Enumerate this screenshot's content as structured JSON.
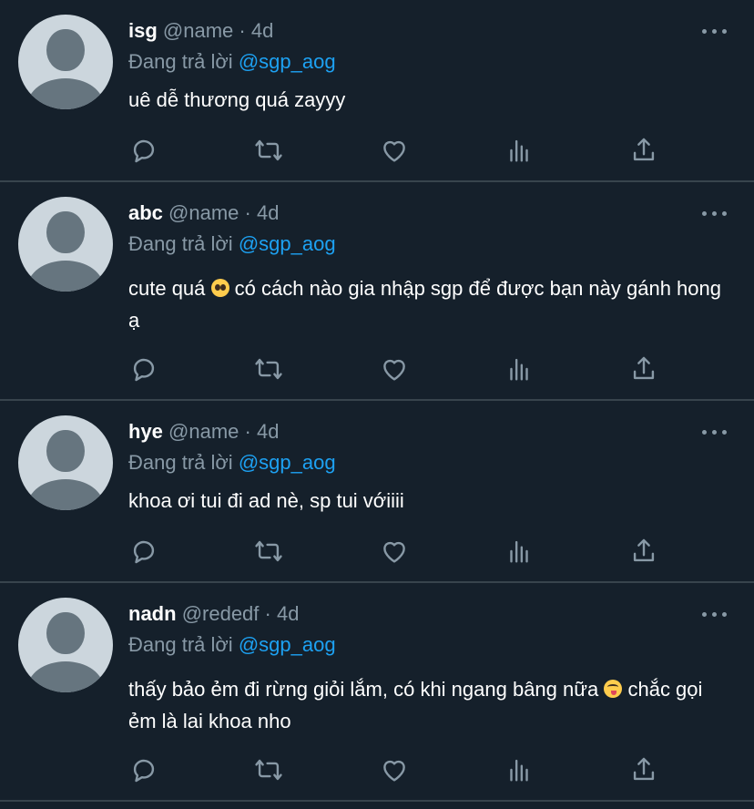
{
  "reply_prefix": "Đang trả lời",
  "colors": {
    "background": "#15202b",
    "divider": "#38444d",
    "muted": "#8899a6",
    "accent": "#1da1f2",
    "text": "#ffffff"
  },
  "action_icons": [
    "reply-icon",
    "retweet-icon",
    "like-icon",
    "analytics-icon",
    "share-icon"
  ],
  "tweets": [
    {
      "name": "isg",
      "handle": "@name",
      "dot": "·",
      "time": "4d",
      "reply_to": "@sgp_aog",
      "text_1": "uê dễ thương quá zayyy"
    },
    {
      "name": "abc",
      "handle": "@name",
      "dot": "·",
      "time": "4d",
      "reply_to": "@sgp_aog",
      "text_1": "cute quá",
      "emoji_1": "pleading-face-emoji",
      "text_2": "có cách nào gia nhập sgp để được bạn này gánh hong ạ"
    },
    {
      "name": "hye",
      "handle": "@name",
      "dot": "·",
      "time": "4d",
      "reply_to": "@sgp_aog",
      "text_1": "khoa ơi tui đi ad nè, sp tui vớiiii"
    },
    {
      "name": "nadn",
      "handle": "@rededf",
      "dot": "·",
      "time": "4d",
      "reply_to": "@sgp_aog",
      "text_1": "thấy bảo ẻm đi rừng giỏi lắm, có khi ngang bâng nữa",
      "emoji_1": "face-savoring-food-emoji",
      "text_2": "chắc gọi ẻm là lai khoa nho"
    }
  ]
}
